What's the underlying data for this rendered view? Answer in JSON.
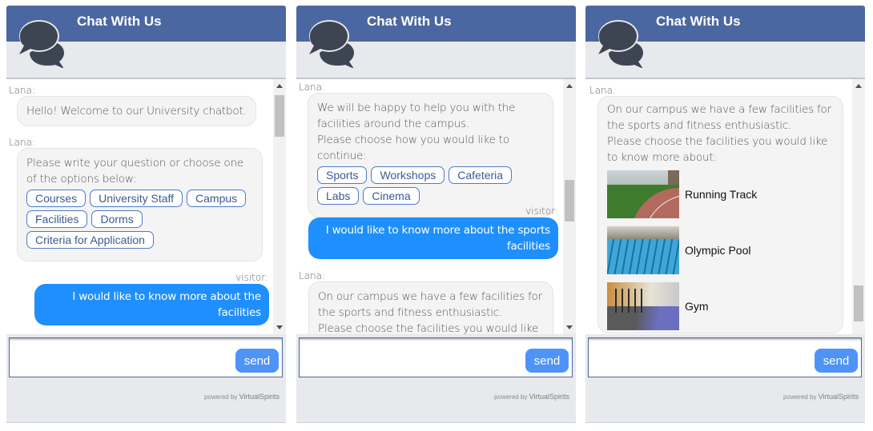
{
  "brand_color": "#4b67a1",
  "visitor_bubble_color": "#1e8ffd",
  "send_button_color": "#4e94f7",
  "panels": [
    {
      "header_title": "Chat With Us",
      "icon": "chat-bubbles-icon",
      "messages": [
        {
          "sender": "Lana:",
          "text": "Hello! Welcome to our University chatbot."
        },
        {
          "sender": "Lana:",
          "text": "Please write your question or choose one of the options below:",
          "options": [
            "Courses",
            "University Staff",
            "Campus",
            "Facilities",
            "Dorms",
            "Criteria for Application"
          ]
        },
        {
          "sender": "visitor:",
          "text": "I would like to know more about the facilities"
        }
      ],
      "input_placeholder": "",
      "send_label": "send",
      "powered_prefix": "powered  by",
      "powered_brand": "VirtualSpirits"
    },
    {
      "header_title": "Chat With Us",
      "icon": "chat-bubbles-icon",
      "messages": [
        {
          "sender": "Lana:",
          "text_line1": "We will be happy to help you with the facilities around the campus.",
          "text_line2": "Please choose how you would like to continue:",
          "options": [
            "Sports",
            "Workshops",
            "Cafeteria",
            "Labs",
            "Cinema"
          ]
        },
        {
          "sender": "visitor:",
          "text": "I would like to know more about the sports facilities"
        },
        {
          "sender": "Lana:",
          "text_line1": "On our campus we have a few facilities for the sports and fitness enthusiastic.",
          "text_line2": "Please choose the facilities you would like to"
        }
      ],
      "input_placeholder": "",
      "send_label": "send",
      "powered_prefix": "powered  by",
      "powered_brand": "VirtualSpirits"
    },
    {
      "header_title": "Chat With Us",
      "icon": "chat-bubbles-icon",
      "messages": [
        {
          "sender": "Lana:",
          "text_line1": "On our campus we have a few facilities for the sports and fitness enthusiastic.",
          "text_line2": "Please choose the facilities you would like to know more about:",
          "facilities": [
            {
              "label": "Running Track",
              "image": "running-track-photo"
            },
            {
              "label": "Olympic Pool",
              "image": "olympic-pool-photo"
            },
            {
              "label": "Gym",
              "image": "gym-photo"
            }
          ]
        }
      ],
      "input_placeholder": "",
      "send_label": "send",
      "powered_prefix": "powered  by",
      "powered_brand": "VirtualSpirits"
    }
  ]
}
